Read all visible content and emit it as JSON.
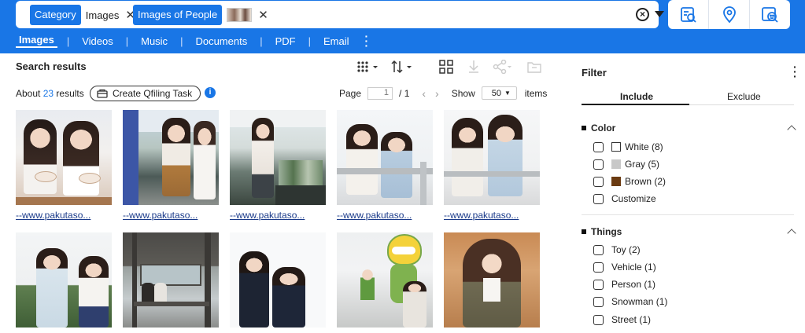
{
  "search": {
    "chips": [
      {
        "key": "Category",
        "value": "Images"
      },
      {
        "key": "Images of People",
        "value": ""
      }
    ]
  },
  "toolbar": {
    "icons": [
      "image-search-icon",
      "location-pin-icon",
      "face-search-icon"
    ]
  },
  "nav": {
    "tabs": [
      "Images",
      "Videos",
      "Music",
      "Documents",
      "PDF",
      "Email"
    ],
    "active": "Images",
    "more": "⋮"
  },
  "results": {
    "title": "Search results",
    "about_prefix": "About",
    "count": "23",
    "about_suffix": "results",
    "create_task_label": "Create Qfiling Task",
    "page_label": "Page",
    "page_value": "1",
    "page_total": "/ 1",
    "show_label": "Show",
    "show_value": "50",
    "items_label": "items"
  },
  "thumbnails": [
    {
      "caption": "--www.pakutaso..."
    },
    {
      "caption": "--www.pakutaso..."
    },
    {
      "caption": "--www.pakutaso..."
    },
    {
      "caption": "--www.pakutaso..."
    },
    {
      "caption": "--www.pakutaso..."
    },
    {
      "caption": ""
    },
    {
      "caption": ""
    },
    {
      "caption": ""
    },
    {
      "caption": ""
    },
    {
      "caption": ""
    }
  ],
  "filter": {
    "title": "Filter",
    "more": "⋮",
    "include_label": "Include",
    "exclude_label": "Exclude",
    "color_section": "Color",
    "colors": [
      {
        "label": "White (8)",
        "swatch": "#ffffff"
      },
      {
        "label": "Gray (5)",
        "swatch": "#c8c8c8"
      },
      {
        "label": "Brown (2)",
        "swatch": "#6b3b12"
      },
      {
        "label": "Customize",
        "swatch": ""
      }
    ],
    "things_section": "Things",
    "things": [
      "Toy (2)",
      "Vehicle (1)",
      "Person (1)",
      "Snowman (1)",
      "Street (1)"
    ]
  },
  "colors": {
    "accent": "#1976e6",
    "link": "#1a3a8a"
  }
}
